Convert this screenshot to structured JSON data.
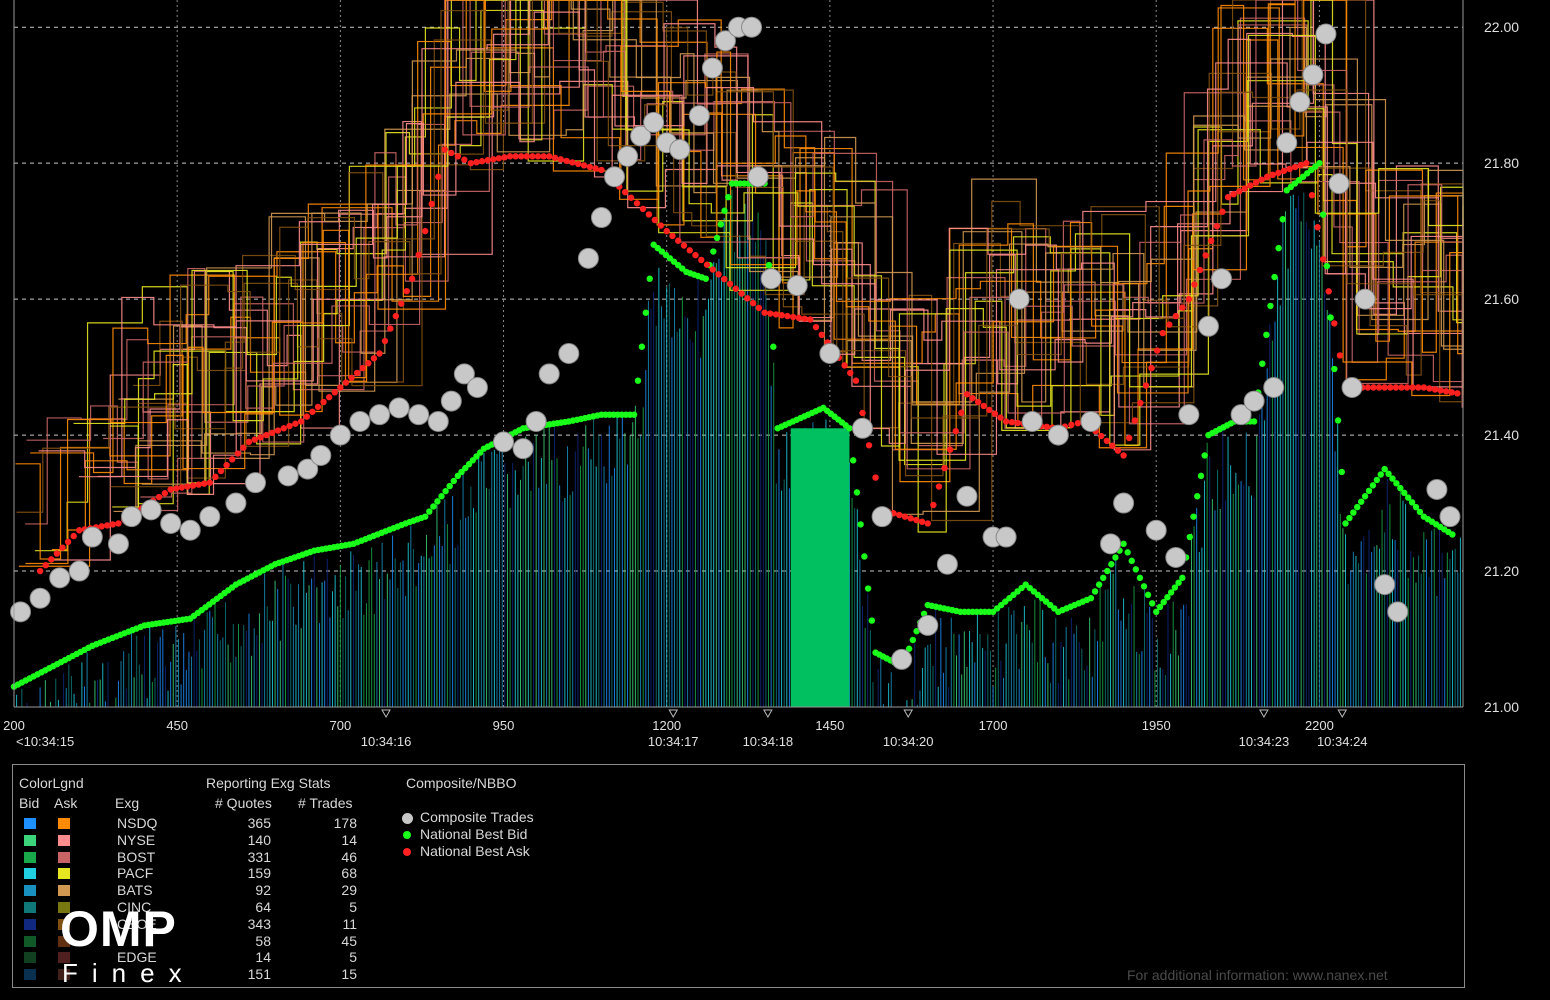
{
  "chart_data": {
    "type": "line",
    "x_tick_labels": [
      "200",
      "450",
      "700",
      "950",
      "1200",
      "1450",
      "1700",
      "1950",
      "2200"
    ],
    "x_ticks": [
      200,
      450,
      700,
      950,
      1200,
      1450,
      1700,
      1950,
      2200
    ],
    "x_range": [
      200,
      2420
    ],
    "time_labels": [
      {
        "x": 200,
        "label": "<10:34:15"
      },
      {
        "x": 770,
        "label": "10:34:16"
      },
      {
        "x": 1210,
        "label": "10:34:17"
      },
      {
        "x": 1355,
        "label": "10:34:18"
      },
      {
        "x": 1570,
        "label": "10:34:20"
      },
      {
        "x": 2115,
        "label": "10:34:23"
      },
      {
        "x": 2235,
        "label": "10:34:24"
      }
    ],
    "y_ticks": [
      21.0,
      21.2,
      21.4,
      21.6,
      21.8,
      22.0
    ],
    "y_tick_labels": [
      "21.00",
      "21.20",
      "21.40",
      "21.60",
      "21.80",
      "22.00"
    ],
    "y_range": [
      21.0,
      22.04
    ],
    "grid": true,
    "series": [
      {
        "name": "National Best Bid",
        "color": "#19ff19",
        "points": [
          [
            200,
            21.03
          ],
          [
            260,
            21.06
          ],
          [
            320,
            21.09
          ],
          [
            400,
            21.12
          ],
          [
            470,
            21.13
          ],
          [
            540,
            21.18
          ],
          [
            600,
            21.21
          ],
          [
            660,
            21.23
          ],
          [
            720,
            21.24
          ],
          [
            800,
            21.27
          ],
          [
            830,
            21.28
          ],
          [
            880,
            21.34
          ],
          [
            920,
            21.38
          ],
          [
            980,
            21.41
          ],
          [
            1050,
            21.42
          ],
          [
            1100,
            21.43
          ],
          [
            1150,
            21.43
          ],
          [
            1180,
            21.68
          ],
          [
            1230,
            21.64
          ],
          [
            1260,
            21.63
          ],
          [
            1300,
            21.77
          ],
          [
            1350,
            21.77
          ],
          [
            1370,
            21.41
          ],
          [
            1440,
            21.44
          ],
          [
            1480,
            21.41
          ],
          [
            1520,
            21.08
          ],
          [
            1560,
            21.06
          ],
          [
            1600,
            21.15
          ],
          [
            1650,
            21.14
          ],
          [
            1700,
            21.14
          ],
          [
            1750,
            21.18
          ],
          [
            1800,
            21.14
          ],
          [
            1850,
            21.16
          ],
          [
            1900,
            21.24
          ],
          [
            1950,
            21.14
          ],
          [
            1990,
            21.19
          ],
          [
            2030,
            21.4
          ],
          [
            2070,
            21.42
          ],
          [
            2100,
            21.42
          ],
          [
            2150,
            21.76
          ],
          [
            2200,
            21.8
          ],
          [
            2240,
            21.27
          ],
          [
            2300,
            21.35
          ],
          [
            2360,
            21.28
          ],
          [
            2410,
            21.25
          ]
        ]
      },
      {
        "name": "National Best Ask",
        "color": "#ff2020",
        "points": [
          [
            240,
            21.2
          ],
          [
            300,
            21.26
          ],
          [
            360,
            21.27
          ],
          [
            440,
            21.32
          ],
          [
            500,
            21.33
          ],
          [
            560,
            21.39
          ],
          [
            640,
            21.42
          ],
          [
            700,
            21.47
          ],
          [
            760,
            21.52
          ],
          [
            810,
            21.63
          ],
          [
            830,
            21.7
          ],
          [
            860,
            21.82
          ],
          [
            900,
            21.8
          ],
          [
            960,
            21.81
          ],
          [
            1020,
            21.81
          ],
          [
            1100,
            21.79
          ],
          [
            1200,
            21.7
          ],
          [
            1350,
            21.58
          ],
          [
            1420,
            21.57
          ],
          [
            1490,
            21.48
          ],
          [
            1530,
            21.29
          ],
          [
            1600,
            21.27
          ],
          [
            1660,
            21.46
          ],
          [
            1720,
            21.42
          ],
          [
            1800,
            21.41
          ],
          [
            1840,
            21.42
          ],
          [
            1900,
            21.37
          ],
          [
            1960,
            21.55
          ],
          [
            2000,
            21.6
          ],
          [
            2060,
            21.75
          ],
          [
            2120,
            21.78
          ],
          [
            2180,
            21.8
          ],
          [
            2240,
            21.47
          ],
          [
            2300,
            21.47
          ],
          [
            2360,
            21.47
          ],
          [
            2420,
            21.46
          ]
        ]
      },
      {
        "name": "Composite Trades",
        "color": "#c8c8c8",
        "points": [
          [
            210,
            21.14
          ],
          [
            240,
            21.16
          ],
          [
            270,
            21.19
          ],
          [
            300,
            21.2
          ],
          [
            320,
            21.25
          ],
          [
            360,
            21.24
          ],
          [
            380,
            21.28
          ],
          [
            410,
            21.29
          ],
          [
            440,
            21.27
          ],
          [
            470,
            21.26
          ],
          [
            500,
            21.28
          ],
          [
            540,
            21.3
          ],
          [
            570,
            21.33
          ],
          [
            620,
            21.34
          ],
          [
            650,
            21.35
          ],
          [
            670,
            21.37
          ],
          [
            700,
            21.4
          ],
          [
            730,
            21.42
          ],
          [
            760,
            21.43
          ],
          [
            790,
            21.44
          ],
          [
            820,
            21.43
          ],
          [
            850,
            21.42
          ],
          [
            870,
            21.45
          ],
          [
            890,
            21.49
          ],
          [
            910,
            21.47
          ],
          [
            950,
            21.39
          ],
          [
            980,
            21.38
          ],
          [
            1000,
            21.42
          ],
          [
            1020,
            21.49
          ],
          [
            1050,
            21.52
          ],
          [
            1080,
            21.66
          ],
          [
            1100,
            21.72
          ],
          [
            1120,
            21.78
          ],
          [
            1140,
            21.81
          ],
          [
            1160,
            21.84
          ],
          [
            1180,
            21.86
          ],
          [
            1200,
            21.83
          ],
          [
            1220,
            21.82
          ],
          [
            1250,
            21.87
          ],
          [
            1270,
            21.94
          ],
          [
            1290,
            21.98
          ],
          [
            1310,
            22.0
          ],
          [
            1330,
            22.0
          ],
          [
            1340,
            21.78
          ],
          [
            1360,
            21.63
          ],
          [
            1400,
            21.62
          ],
          [
            1450,
            21.52
          ],
          [
            1500,
            21.41
          ],
          [
            1530,
            21.28
          ],
          [
            1560,
            21.07
          ],
          [
            1600,
            21.12
          ],
          [
            1630,
            21.21
          ],
          [
            1660,
            21.31
          ],
          [
            1700,
            21.25
          ],
          [
            1720,
            21.25
          ],
          [
            1740,
            21.6
          ],
          [
            1760,
            21.42
          ],
          [
            1800,
            21.4
          ],
          [
            1850,
            21.42
          ],
          [
            1880,
            21.24
          ],
          [
            1900,
            21.3
          ],
          [
            1950,
            21.26
          ],
          [
            1980,
            21.22
          ],
          [
            2000,
            21.43
          ],
          [
            2030,
            21.56
          ],
          [
            2050,
            21.63
          ],
          [
            2080,
            21.43
          ],
          [
            2100,
            21.45
          ],
          [
            2130,
            21.47
          ],
          [
            2150,
            21.83
          ],
          [
            2170,
            21.89
          ],
          [
            2190,
            21.93
          ],
          [
            2210,
            21.99
          ],
          [
            2230,
            21.77
          ],
          [
            2250,
            21.47
          ],
          [
            2270,
            21.6
          ],
          [
            2300,
            21.18
          ],
          [
            2320,
            21.14
          ],
          [
            2380,
            21.32
          ],
          [
            2400,
            21.28
          ]
        ]
      }
    ]
  },
  "legend": {
    "color_legend_title": "ColorLgnd",
    "bid_header": "Bid",
    "ask_header": "Ask",
    "exg_header": "Exg",
    "stats_title": "Reporting Exg Stats",
    "quotes_header": "# Quotes",
    "trades_header": "# Trades",
    "rows": [
      {
        "exg": "NSDQ",
        "quotes": "365",
        "trades": "178",
        "bid_color": "#1e90ff",
        "ask_color": "#ff8c00"
      },
      {
        "exg": "NYSE",
        "quotes": "140",
        "trades": "14",
        "bid_color": "#3cd47a",
        "ask_color": "#ff8c8c"
      },
      {
        "exg": "BOST",
        "quotes": "331",
        "trades": "46",
        "bid_color": "#19a84a",
        "ask_color": "#c86464"
      },
      {
        "exg": "PACF",
        "quotes": "159",
        "trades": "68",
        "bid_color": "#20d0e0",
        "ask_color": "#e6e620"
      },
      {
        "exg": "BATS",
        "quotes": "92",
        "trades": "29",
        "bid_color": "#1890c0",
        "ask_color": "#d09850"
      },
      {
        "exg": "CINC",
        "quotes": "64",
        "trades": "5",
        "bid_color": "#107878",
        "ask_color": "#787810"
      },
      {
        "exg": "CBOE",
        "quotes": "343",
        "trades": "11",
        "bid_color": "#102880",
        "ask_color": "#805010"
      },
      {
        "exg": "",
        "quotes": "58",
        "trades": "45",
        "bid_color": "#105a28",
        "ask_color": "#603010"
      },
      {
        "exg": "EDGE",
        "quotes": "14",
        "trades": "5",
        "bid_color": "#104020",
        "ask_color": "#502020"
      },
      {
        "exg": "",
        "quotes": "151",
        "trades": "15",
        "bid_color": "#0a3050",
        "ask_color": "#402018"
      }
    ],
    "nbbo_title": "Composite/NBBO",
    "nbbo_items": [
      {
        "label": "Composite Trades",
        "color": "#c8c8c8"
      },
      {
        "label": "National Best Bid",
        "color": "#19ff19"
      },
      {
        "label": "National Best Ask",
        "color": "#ff2020"
      }
    ]
  },
  "logo": {
    "word": "OMP",
    "sub": "Finex"
  },
  "footer": "For additional information: www.nanex.net"
}
